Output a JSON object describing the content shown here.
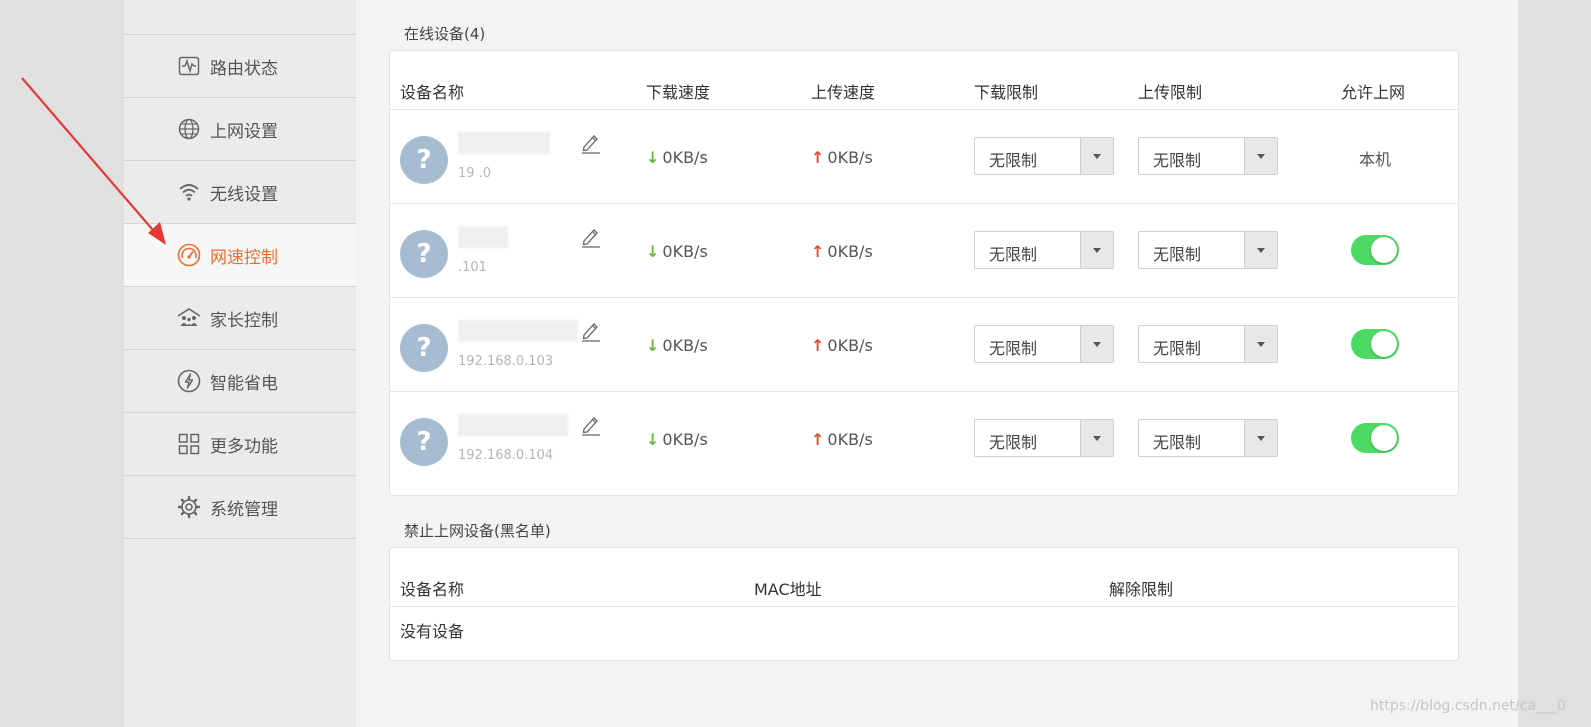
{
  "sidebar": {
    "items": [
      {
        "label": "路由状态",
        "icon": "pulse-monitor-icon"
      },
      {
        "label": "上网设置",
        "icon": "globe-icon"
      },
      {
        "label": "无线设置",
        "icon": "wifi-icon"
      },
      {
        "label": "网速控制",
        "icon": "speedometer-icon",
        "active": true
      },
      {
        "label": "家长控制",
        "icon": "family-icon"
      },
      {
        "label": "智能省电",
        "icon": "lightning-circle-icon"
      },
      {
        "label": "更多功能",
        "icon": "grid-icon"
      },
      {
        "label": "系统管理",
        "icon": "gear-icon"
      }
    ],
    "active_color": "#ea6f2d"
  },
  "online": {
    "title": "在线设备(4)",
    "headers": {
      "name": "设备名称",
      "down_speed": "下载速度",
      "up_speed": "上传速度",
      "down_limit": "下载限制",
      "up_limit": "上传限制",
      "allow": "允许上网"
    },
    "devices": [
      {
        "ip": "19          .0",
        "down": "0KB/s",
        "up": "0KB/s",
        "down_limit": "无限制",
        "up_limit": "无限制",
        "allow": "本机"
      },
      {
        "ip": "           .101",
        "down": "0KB/s",
        "up": "0KB/s",
        "down_limit": "无限制",
        "up_limit": "无限制",
        "allow_toggle": true
      },
      {
        "ip": "192.168.0.103",
        "down": "0KB/s",
        "up": "0KB/s",
        "down_limit": "无限制",
        "up_limit": "无限制",
        "allow_toggle": true
      },
      {
        "ip": "192.168.0.104",
        "down": "0KB/s",
        "up": "0KB/s",
        "down_limit": "无限制",
        "up_limit": "无限制",
        "allow_toggle": true
      }
    ],
    "arrow_down": "↓",
    "arrow_up": "↑",
    "avatar_glyph": "?"
  },
  "blacklist": {
    "title": "禁止上网设备(黑名单)",
    "headers": {
      "name": "设备名称",
      "mac": "MAC地址",
      "release": "解除限制"
    },
    "empty": "没有设备"
  },
  "watermark": "https://blog.csdn.net/ca___0",
  "colors": {
    "toggle_on": "#4cd964",
    "down_arrow": "#6db33f",
    "up_arrow": "#e34c26",
    "avatar": "#a6bdd1"
  }
}
